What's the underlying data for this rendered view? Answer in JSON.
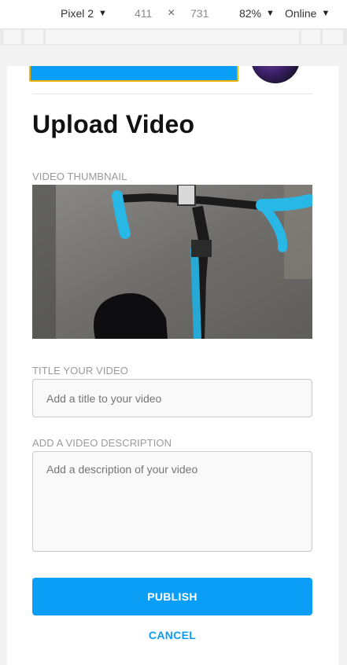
{
  "devtools": {
    "device": "Pixel 2",
    "width": "411",
    "times": "×",
    "height": "731",
    "zoom": "82%",
    "network": "Online",
    "arrow": "▼"
  },
  "page": {
    "title": "Upload Video",
    "thumbnail_label": "VIDEO THUMBNAIL",
    "title_label": "TITLE YOUR VIDEO",
    "title_placeholder": "Add a title to your video",
    "description_label": "ADD A VIDEO DESCRIPTION",
    "description_placeholder": "Add a description of your video",
    "publish_label": "PUBLISH",
    "cancel_label": "CANCEL"
  },
  "colors": {
    "accent": "#0a9ef7",
    "focus_outline": "#f0b400",
    "label_gray": "#9a9a9a"
  }
}
